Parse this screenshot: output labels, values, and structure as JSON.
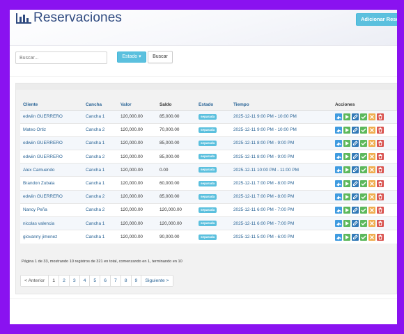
{
  "header": {
    "title": "Reservaciones",
    "add_button": "Adicionar Reservación",
    "logo_icon": "bar-chart-icon"
  },
  "search": {
    "placeholder": "Buscar...",
    "estado_button": "Estado ▾",
    "search_button": "Buscar"
  },
  "table": {
    "columns": [
      "Cliente",
      "Cancha",
      "Valor",
      "Saldo",
      "Estado",
      "Tiempo",
      "Acciones"
    ],
    "rows": [
      {
        "cliente": "edwiin GUERRERO",
        "cancha": "Cancha 1",
        "valor": "120,000.00",
        "saldo": "85,000.00",
        "estado": "separada",
        "tiempo": "2025-12-11 9:00 PM - 10:00 PM"
      },
      {
        "cliente": "Mateo Ortiz",
        "cancha": "Cancha 2",
        "valor": "120,000.00",
        "saldo": "70,000.00",
        "estado": "separada",
        "tiempo": "2025-12-11 9:00 PM - 10:00 PM"
      },
      {
        "cliente": "edwiin GUERRERO",
        "cancha": "Cancha 1",
        "valor": "120,000.00",
        "saldo": "85,000.00",
        "estado": "separada",
        "tiempo": "2025-12-11 8:00 PM - 9:00 PM"
      },
      {
        "cliente": "edwiin GUERRERO",
        "cancha": "Cancha 2",
        "valor": "120,000.00",
        "saldo": "85,000.00",
        "estado": "separada",
        "tiempo": "2025-12-11 8:00 PM - 9:00 PM"
      },
      {
        "cliente": "Alex Camuendo",
        "cancha": "Cancha 1",
        "valor": "120,000.00",
        "saldo": "0.00",
        "estado": "separada",
        "tiempo": "2025-12-11 10:00 PM - 11:00 PM"
      },
      {
        "cliente": "Brandon Zubala",
        "cancha": "Cancha 1",
        "valor": "120,000.00",
        "saldo": "60,000.00",
        "estado": "separada",
        "tiempo": "2025-12-11 7:00 PM - 8:00 PM"
      },
      {
        "cliente": "edwiin GUERRERO",
        "cancha": "Cancha 2",
        "valor": "120,000.00",
        "saldo": "85,000.00",
        "estado": "separada",
        "tiempo": "2025-12-11 7:00 PM - 8:00 PM"
      },
      {
        "cliente": "Nancy Peña",
        "cancha": "Cancha 2",
        "valor": "120,000.00",
        "saldo": "120,000.00",
        "estado": "separada",
        "tiempo": "2025-12-11 6:00 PM - 7:00 PM"
      },
      {
        "cliente": "nicolas valencia",
        "cancha": "Cancha 1",
        "valor": "120,000.00",
        "saldo": "120,000.00",
        "estado": "separada",
        "tiempo": "2025-12-11 6:00 PM - 7:00 PM"
      },
      {
        "cliente": "giovanny jimenez",
        "cancha": "Cancha 1",
        "valor": "120,000.00",
        "saldo": "90,000.00",
        "estado": "separada",
        "tiempo": "2025-12-11 5:00 PM - 6:00 PM"
      }
    ],
    "actions": [
      {
        "name": "share-icon",
        "color": "#3f9be0"
      },
      {
        "name": "play-icon",
        "color": "#5cb85c"
      },
      {
        "name": "edit-icon",
        "color": "#337ab7"
      },
      {
        "name": "check-icon",
        "color": "#5cb85c"
      },
      {
        "name": "close-icon",
        "color": "#f0ad4e"
      },
      {
        "name": "trash-icon",
        "color": "#d9534f"
      }
    ]
  },
  "summary": "Página 1 de 33, mostrando 10 registros de 321 en total, comenzando en 1, terminando en 10",
  "pagination": {
    "prev": "< Anterior",
    "pages": [
      "1",
      "2",
      "3",
      "4",
      "5",
      "6",
      "7",
      "8",
      "9"
    ],
    "next": "Siguiente >",
    "current": "1"
  },
  "colors": {
    "frame": "#8a12f0",
    "accent": "#5bc0de",
    "link": "#2a6496",
    "title": "#2f4a80"
  }
}
